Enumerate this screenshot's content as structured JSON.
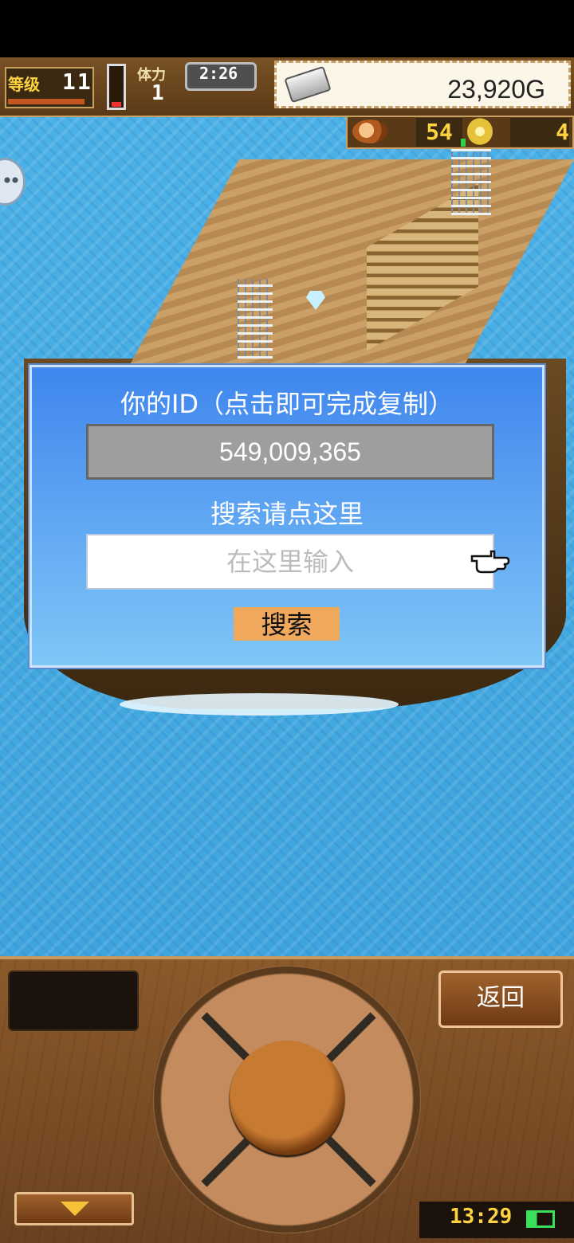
{
  "hud": {
    "level_label": "等级",
    "level_value": "11",
    "stamina_label": "体力",
    "stamina_value": "1",
    "clock": "2:26",
    "gold": "23,920G",
    "food": "54",
    "coins": "4"
  },
  "dialog": {
    "id_label": "你的ID（点击即可完成复制）",
    "id_value": "549,009,365",
    "search_hint": "搜索请点这里",
    "search_placeholder": "在这里输入",
    "search_button": "搜索"
  },
  "bottom": {
    "back_button": "返回",
    "time": "13:29"
  },
  "colors": {
    "dialog_bg": "#3f86ee",
    "button": "#f0a85c",
    "ocean": "#4cb1e6",
    "wood": "#8b5a2b"
  }
}
